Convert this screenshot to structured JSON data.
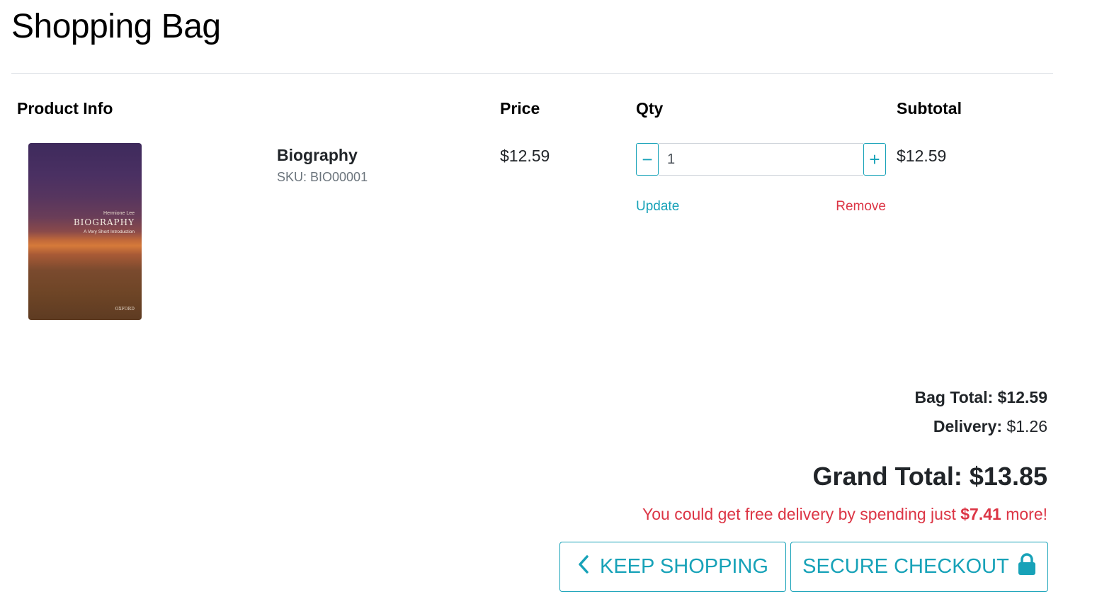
{
  "page": {
    "title": "Shopping Bag"
  },
  "table": {
    "headers": {
      "product_info": "Product Info",
      "price": "Price",
      "qty": "Qty",
      "subtotal": "Subtotal"
    }
  },
  "items": [
    {
      "name": "Biography",
      "sku": "SKU: BIO00001",
      "price": "$12.59",
      "quantity": "1",
      "subtotal": "$12.59",
      "cover": {
        "author": "Hermione Lee",
        "title": "BIOGRAPHY",
        "subtitle": "A Very Short Introduction",
        "publisher": "OXFORD"
      },
      "actions": {
        "update": "Update",
        "remove": "Remove",
        "decrement": "−",
        "increment": "+"
      }
    }
  ],
  "summary": {
    "bag_total_label": "Bag Total:",
    "bag_total": "$12.59",
    "delivery_label": "Delivery:",
    "delivery": "$1.26",
    "grand_total_label": "Grand Total:",
    "grand_total": "$13.85",
    "free_delivery_prefix": "You could get free delivery by spending just",
    "free_delivery_amount": "$7.41",
    "free_delivery_suffix": "more!"
  },
  "buttons": {
    "keep_shopping": "KEEP SHOPPING",
    "secure_checkout": "SECURE CHECKOUT"
  },
  "colors": {
    "accent": "#17a2b8",
    "danger": "#dc3545",
    "text": "#212529",
    "muted": "#6c757d"
  },
  "icons": {
    "keep_shopping": "chevron-left-icon",
    "checkout": "lock-icon"
  }
}
